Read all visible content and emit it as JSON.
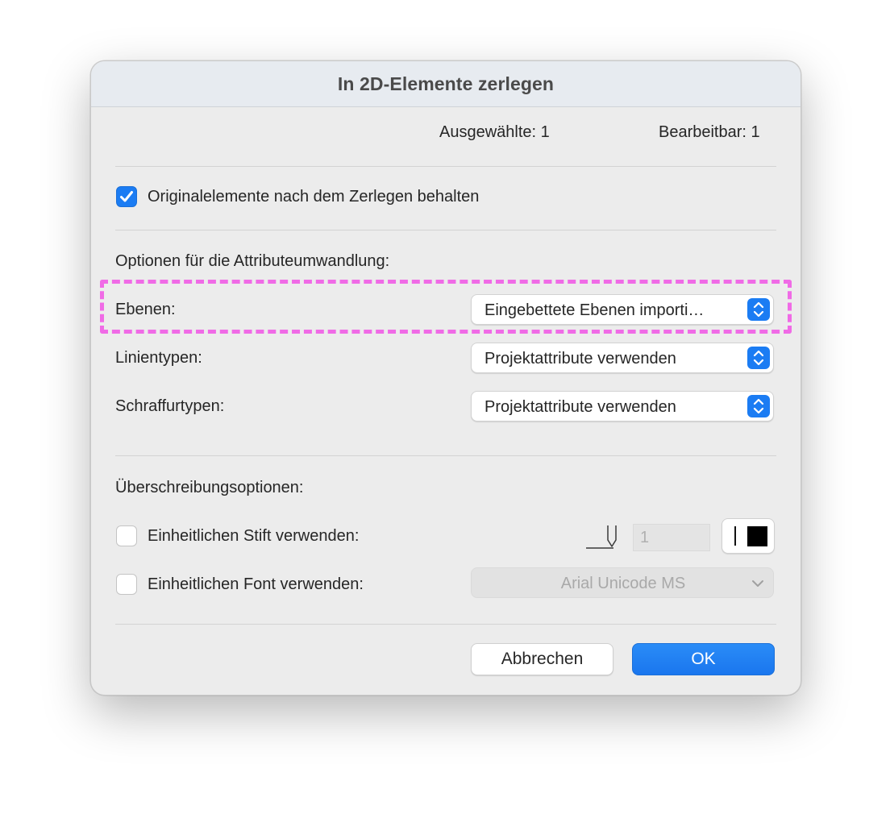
{
  "dialog": {
    "title": "In 2D-Elemente zerlegen",
    "stats": {
      "selected": "Ausgewählte: 1",
      "editable": "Bearbeitbar: 1"
    },
    "keep_originals": {
      "label": "Originalelemente nach dem Zerlegen behalten",
      "checked": true
    },
    "attribute_section": {
      "heading": "Optionen für die Attributeumwandlung:",
      "rows": [
        {
          "label": "Ebenen:",
          "value": "Eingebettete Ebenen importi…"
        },
        {
          "label": "Linientypen:",
          "value": "Projektattribute verwenden"
        },
        {
          "label": "Schraffurtypen:",
          "value": "Projektattribute verwenden"
        }
      ]
    },
    "override_section": {
      "heading": "Überschreibungsoptionen:",
      "uniform_pen": {
        "label": "Einheitlichen Stift verwenden:",
        "checked": false,
        "pen_number": "1"
      },
      "uniform_font": {
        "label": "Einheitlichen Font verwenden:",
        "checked": false,
        "font": "Arial Unicode MS"
      }
    },
    "buttons": {
      "cancel": "Abbrechen",
      "ok": "OK"
    }
  },
  "colors": {
    "accent": "#1b7cf3",
    "highlight": "#f06be6",
    "dialog_bg": "#ececec"
  },
  "icons": [
    "checkmark-icon",
    "stepper-icon",
    "pen-icon",
    "chevron-down-icon",
    "color-swatch-icon"
  ]
}
